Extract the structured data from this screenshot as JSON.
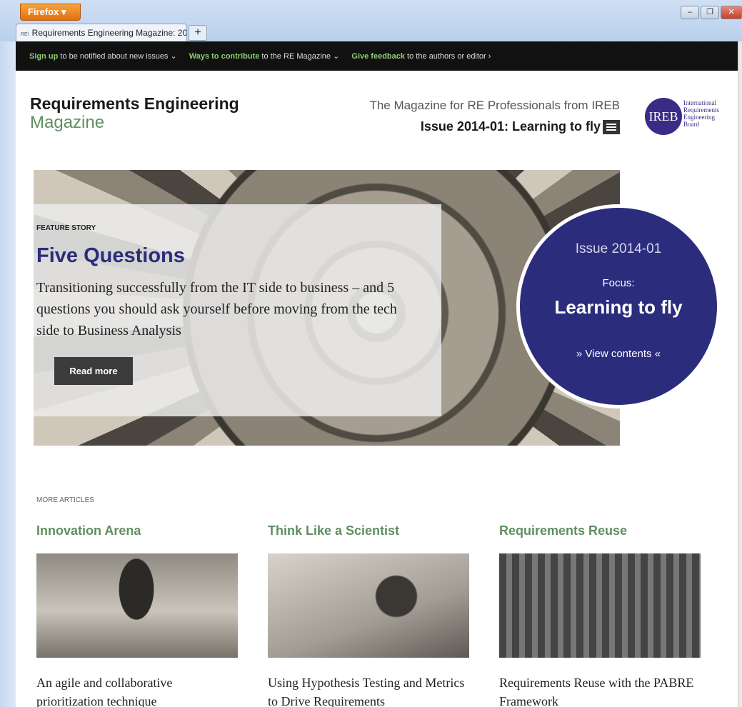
{
  "browser": {
    "app_button": "Firefox",
    "tab_title": "Requirements Engineering Magazine: 20...",
    "tab_favicon": "RE\\",
    "new_tab": "+",
    "window_buttons": {
      "minimize": "–",
      "restore": "❐",
      "close": "✕"
    }
  },
  "topbar": {
    "signup_link": "Sign up",
    "signup_text": " to be notified about new issues ⌄",
    "contribute_link": "Ways to contribute",
    "contribute_text": " to the RE Magazine ⌄",
    "feedback_link": "Give feedback",
    "feedback_text": " to the authors or editor ›"
  },
  "header": {
    "brand_line1": "Requirements Engineering",
    "brand_line2": "Magazine",
    "tagline": "The Magazine for RE Professionals from IREB",
    "issue": "Issue 2014-01: Learning to fly",
    "logo_text": "IREB",
    "logo_sub": [
      "International",
      "Requirements",
      "Engineering",
      "Board"
    ]
  },
  "hero": {
    "kicker": "FEATURE STORY",
    "title": "Five Questions",
    "description": "Transitioning successfully from the IT side to business – and 5 questions you should ask yourself before moving from the tech side to Business Analysis",
    "button": "Read more"
  },
  "issue_circle": {
    "issue": "Issue 2014-01",
    "focus_label": "Focus:",
    "focus_title": "Learning to fly",
    "link": "» View contents «"
  },
  "articles": {
    "label": "MORE ARTICLES",
    "items": [
      {
        "category": "Innovation Arena",
        "title": "An agile and collaborative prioritization technique"
      },
      {
        "category": "Think Like a Scientist",
        "title": "Using Hypothesis Testing and Metrics to Drive Requirements"
      },
      {
        "category": "Requirements Reuse",
        "title": "Requirements Reuse with the PABRE Framework"
      }
    ]
  }
}
